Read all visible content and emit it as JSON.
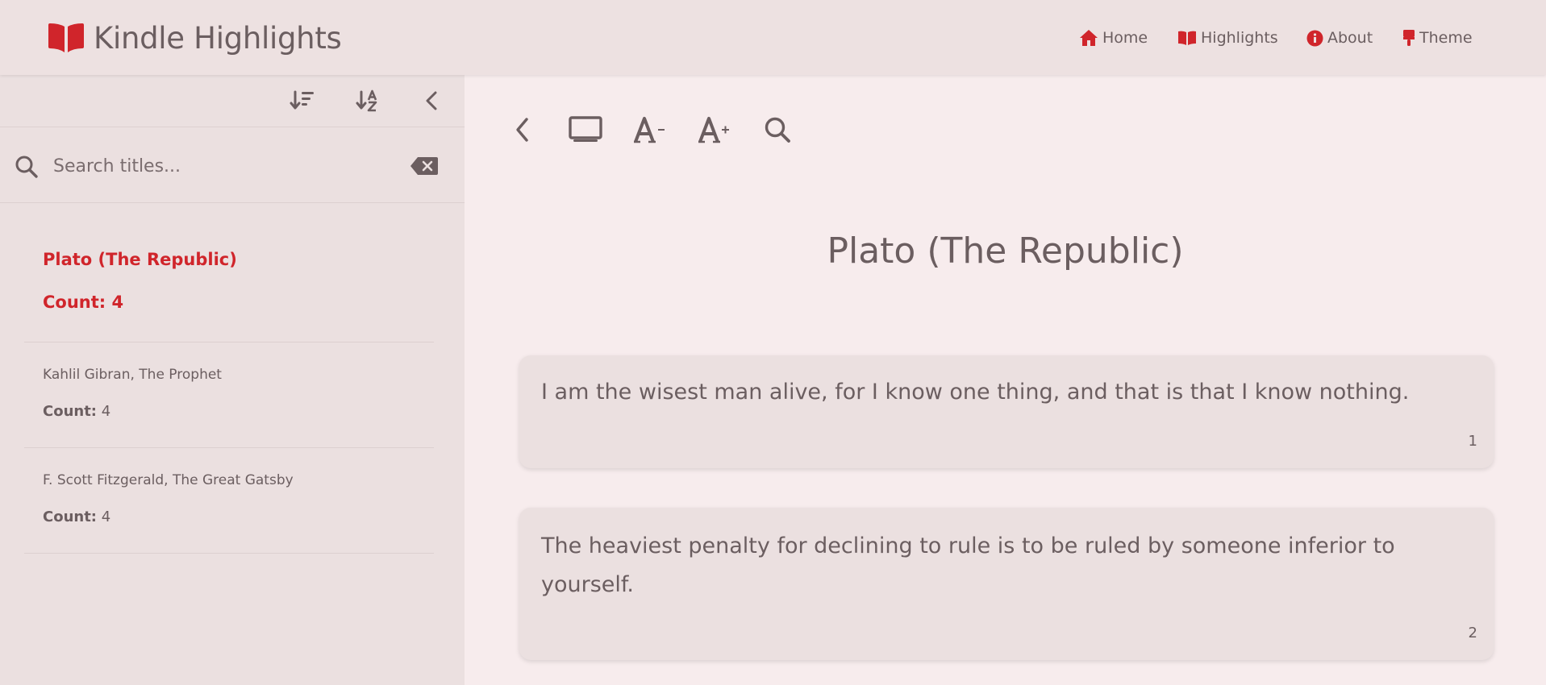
{
  "app": {
    "title": "Kindle Highlights",
    "brand_color": "#d0252b",
    "icon": "book-open-icon"
  },
  "nav": [
    {
      "label": "Home",
      "icon": "home-icon"
    },
    {
      "label": "Highlights",
      "icon": "book-open-icon"
    },
    {
      "label": "About",
      "icon": "info-icon"
    },
    {
      "label": "Theme",
      "icon": "paint-brush-icon"
    }
  ],
  "sidebar": {
    "tools": [
      "sort-amount-icon",
      "sort-alpha-icon",
      "collapse-chevron-icon"
    ],
    "search": {
      "placeholder": "Search titles...",
      "value": "",
      "icon": "search-icon",
      "clear_icon": "backspace-icon"
    },
    "books": [
      {
        "title": "Plato (The Republic)",
        "count_label": "Count:",
        "count": "4",
        "active": true
      },
      {
        "title": "Kahlil Gibran, The Prophet",
        "count_label": "Count:",
        "count": "4",
        "active": false
      },
      {
        "title": "F. Scott Fitzgerald, The Great Gatsby",
        "count_label": "Count:",
        "count": "4",
        "active": false
      }
    ]
  },
  "reader": {
    "tools": [
      "back-chevron-icon",
      "display-mode-icon",
      "font-decrease-icon",
      "font-increase-icon",
      "search-icon"
    ],
    "title": "Plato (The Republic)",
    "highlights": [
      {
        "text": "I am the wisest man alive, for I know one thing, and that is that I know nothing.",
        "number": "1"
      },
      {
        "text": "The heaviest penalty for declining to rule is to be ruled by someone inferior to yourself.",
        "number": "2"
      }
    ]
  },
  "colors": {
    "accent": "#d0252b",
    "text": "#6b5e60",
    "header_bg": "#ede1e1",
    "sidebar_bg": "#ebe0e0",
    "main_bg": "#f7eced"
  }
}
